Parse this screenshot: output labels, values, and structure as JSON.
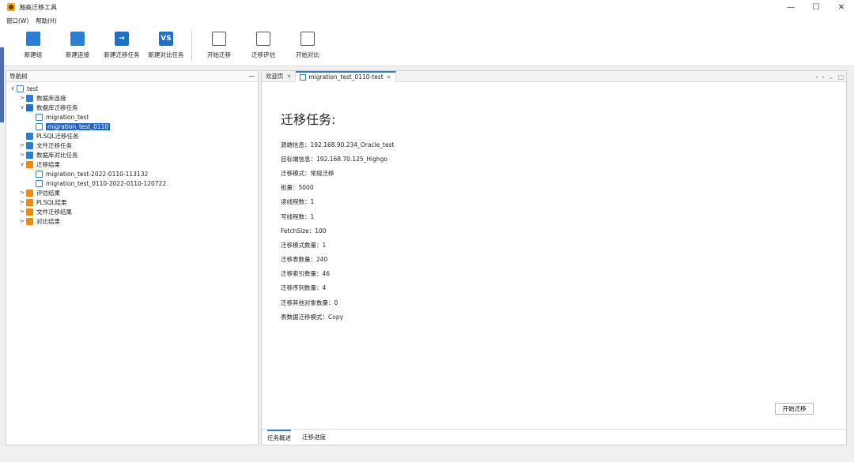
{
  "window": {
    "title": "瀚高迁移工具"
  },
  "menu": [
    "窗口(W)",
    "帮助(H)"
  ],
  "toolbar": [
    {
      "label": "新建组",
      "icon": "group-icon",
      "color": "#2a7fd4",
      "glyph": ""
    },
    {
      "label": "新建连接",
      "icon": "connection-icon",
      "color": "#2a7fd4",
      "glyph": ""
    },
    {
      "label": "新建迁移任务",
      "icon": "migration-task-icon",
      "color": "#1d6fc7",
      "glyph": "→"
    },
    {
      "label": "新建对比任务",
      "icon": "compare-task-icon",
      "color": "#1d6fc7",
      "glyph": "VS"
    },
    {
      "label": "开始迁移",
      "icon": "data-icon",
      "color": "#ffffff",
      "glyph": ""
    },
    {
      "label": "迁移评估",
      "icon": "pg-icon",
      "color": "#ffffff",
      "glyph": ""
    },
    {
      "label": "开始对比",
      "icon": "compare-icon",
      "color": "#ffffff",
      "glyph": ""
    }
  ],
  "nav": {
    "title": "导航树",
    "tree": [
      {
        "label": "test",
        "level": 0,
        "arrow": "∨",
        "icon": "ic-db",
        "icon_name": "database-icon",
        "selected": false
      },
      {
        "label": "数据库连接",
        "level": 1,
        "arrow": ">",
        "icon": "ic-conn",
        "icon_name": "connection-icon",
        "selected": false
      },
      {
        "label": "数据库迁移任务",
        "level": 1,
        "arrow": "∨",
        "icon": "ic-task",
        "icon_name": "migration-task-icon",
        "selected": false
      },
      {
        "label": "migration_test",
        "level": 2,
        "arrow": "",
        "icon": "ic-doc",
        "icon_name": "task-doc-icon",
        "selected": false
      },
      {
        "label": "migration_test_0110",
        "level": 2,
        "arrow": "",
        "icon": "ic-doc",
        "icon_name": "task-doc-icon",
        "selected": true
      },
      {
        "label": "PLSQL迁移任务",
        "level": 1,
        "arrow": "",
        "icon": "ic-p",
        "icon_name": "plsql-icon",
        "selected": false
      },
      {
        "label": "文件迁移任务",
        "level": 1,
        "arrow": ">",
        "icon": "ic-f",
        "icon_name": "file-icon",
        "selected": false
      },
      {
        "label": "数据库对比任务",
        "level": 1,
        "arrow": ">",
        "icon": "ic-vs",
        "icon_name": "compare-icon",
        "selected": false
      },
      {
        "label": "迁移结果",
        "level": 1,
        "arrow": "∨",
        "icon": "ic-folder",
        "icon_name": "folder-icon",
        "selected": false
      },
      {
        "label": "migration_test-2022-0110-113132",
        "level": 2,
        "arrow": "",
        "icon": "ic-doc",
        "icon_name": "result-doc-icon",
        "selected": false
      },
      {
        "label": "migration_test_0110-2022-0110-120722",
        "level": 2,
        "arrow": "",
        "icon": "ic-doc",
        "icon_name": "result-doc-icon",
        "selected": false
      },
      {
        "label": "评估结果",
        "level": 1,
        "arrow": ">",
        "icon": "ic-folder",
        "icon_name": "folder-icon",
        "selected": false
      },
      {
        "label": "PLSQL结果",
        "level": 1,
        "arrow": ">",
        "icon": "ic-folder",
        "icon_name": "folder-icon",
        "selected": false
      },
      {
        "label": "文件迁移结果",
        "level": 1,
        "arrow": ">",
        "icon": "ic-folder",
        "icon_name": "folder-icon",
        "selected": false
      },
      {
        "label": "对比结果",
        "level": 1,
        "arrow": ">",
        "icon": "ic-folder",
        "icon_name": "folder-icon",
        "selected": false
      }
    ]
  },
  "tabs": [
    {
      "label": "欢迎页",
      "active": false
    },
    {
      "label": "migration_test_0110-test",
      "active": true
    }
  ],
  "task": {
    "heading": "迁移任务:",
    "rows": [
      "源端信息：192.168.90.234_Oracle_test",
      "目标端信息：192.168.70.125_Highgo",
      "迁移模式：常规迁移",
      "批量：5000",
      "读线程数：1",
      "写线程数：1",
      "FetchSize：100",
      "迁移模式数量：1",
      "迁移表数量：240",
      "迁移索引数量：46",
      "迁移序列数量：4",
      "迁移其他对象数量：0",
      "表数据迁移模式：Copy"
    ],
    "start_button": "开始迁移"
  },
  "bottom_tabs": [
    "任务概述",
    "迁移进度"
  ]
}
